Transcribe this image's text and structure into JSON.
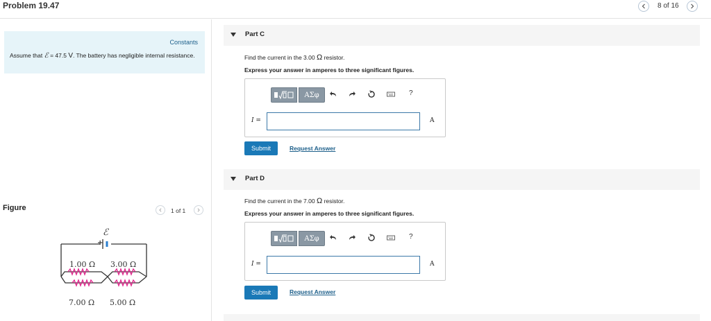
{
  "header": {
    "title": "Problem 19.47",
    "page_indicator": "8 of 16"
  },
  "constants": {
    "link_label": "Constants",
    "assume_prefix": "Assume that",
    "emf_symbol": "ℰ",
    "equals": "= 47.5",
    "unit": "V",
    "assume_suffix": ". The battery has negligible internal resistance."
  },
  "figure": {
    "label": "Figure",
    "page": "1 of 1",
    "circuit": {
      "emf_label": "ℰ",
      "plus": "+",
      "r1": "1.00 Ω",
      "r2": "3.00 Ω",
      "r3": "7.00 Ω",
      "r4": "5.00 Ω",
      "resistor_color": "#e0218a"
    }
  },
  "parts": [
    {
      "title": "Part C",
      "question_prefix": "Find the current in the 3.00",
      "question_omega": "Ω",
      "question_suffix": "resistor.",
      "instruction": "Express your answer in amperes to three significant figures.",
      "symbol_button": "ΑΣφ",
      "help": "?",
      "variable": "I =",
      "answer_value": "",
      "unit": "A",
      "submit": "Submit",
      "request": "Request Answer"
    },
    {
      "title": "Part D",
      "question_prefix": "Find the current in the 7.00",
      "question_omega": "Ω",
      "question_suffix": "resistor.",
      "instruction": "Express your answer in amperes to three significant figures.",
      "symbol_button": "ΑΣφ",
      "help": "?",
      "variable": "I =",
      "answer_value": "",
      "unit": "A",
      "submit": "Submit",
      "request": "Request Answer"
    }
  ],
  "icons": [
    "chevron-left-icon",
    "chevron-right-icon",
    "undo-icon",
    "redo-icon",
    "reset-icon",
    "keyboard-icon",
    "template-icon"
  ],
  "colors": {
    "accent": "#1a79b7",
    "link": "#1d5f8a",
    "constants_bg": "#e6f4f9",
    "toolbar_bg": "#8a98a4"
  }
}
